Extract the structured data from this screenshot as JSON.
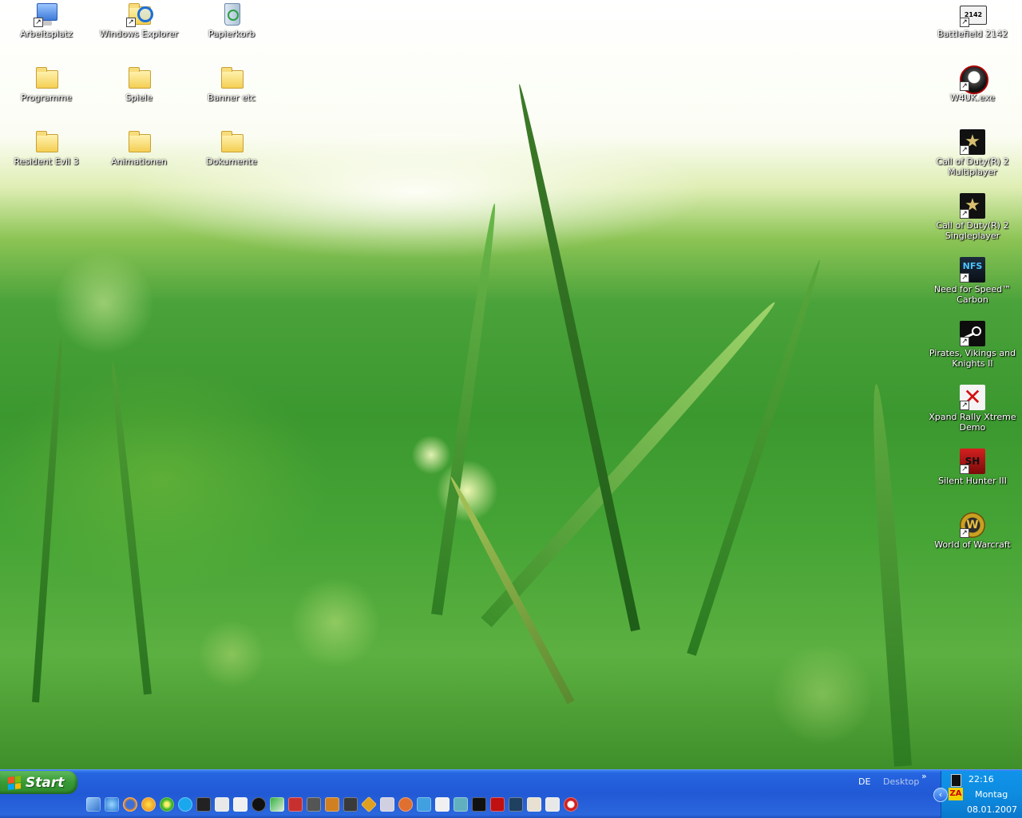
{
  "desktop_icons_left": [
    {
      "name": "icon-arbeitsplatz",
      "label": "Arbeitsplatz",
      "icon": "my-computer-icon"
    },
    {
      "name": "icon-windows-explorer",
      "label": "Windows Explorer",
      "icon": "explorer-icon"
    },
    {
      "name": "icon-papierkorb",
      "label": "Papierkorb",
      "icon": "recycle-bin-icon"
    },
    {
      "name": "icon-programme",
      "label": "Programme",
      "icon": "folder-icon"
    },
    {
      "name": "icon-spiele",
      "label": "Spiele",
      "icon": "folder-icon"
    },
    {
      "name": "icon-banner-etc",
      "label": "Banner etc",
      "icon": "folder-icon"
    },
    {
      "name": "icon-resident-evil-3",
      "label": "Resident Evil 3",
      "icon": "folder-icon"
    },
    {
      "name": "icon-animationen",
      "label": "Animationen",
      "icon": "folder-icon"
    },
    {
      "name": "icon-dokumente",
      "label": "Dokumente",
      "icon": "folder-icon"
    }
  ],
  "desktop_icons_right": [
    {
      "name": "icon-battlefield-2142",
      "label": "Battlefield 2142",
      "icon": "battlefield-icon"
    },
    {
      "name": "icon-w4uk",
      "label": "W4UK.exe",
      "icon": "skull-icon"
    },
    {
      "name": "icon-cod2-mp",
      "label": "Call of Duty(R) 2 Multiplayer",
      "icon": "cod2-icon"
    },
    {
      "name": "icon-cod2-sp",
      "label": "Call of Duty(R) 2 Singleplayer",
      "icon": "cod2-icon"
    },
    {
      "name": "icon-nfs-carbon",
      "label": "Need for Speed™ Carbon",
      "icon": "nfs-icon"
    },
    {
      "name": "icon-pirates-vikings",
      "label": "Pirates, Vikings and Knights II",
      "icon": "steam-icon"
    },
    {
      "name": "icon-xpand-rally",
      "label": "Xpand Rally Xtreme Demo",
      "icon": "xpand-rally-icon"
    },
    {
      "name": "icon-silent-hunter",
      "label": "Silent Hunter III",
      "icon": "silent-hunter-icon"
    },
    {
      "name": "icon-wow",
      "label": "World of Warcraft",
      "icon": "wow-icon"
    }
  ],
  "taskbar": {
    "start_label": "Start",
    "language": "DE",
    "desktop_toolbar": "Desktop",
    "chevron": "»",
    "quicklaunch_count": 27
  },
  "tray": {
    "time": "22:16",
    "day": "Montag",
    "date": "08.01.2007",
    "expand": "‹",
    "za": "ZA"
  }
}
